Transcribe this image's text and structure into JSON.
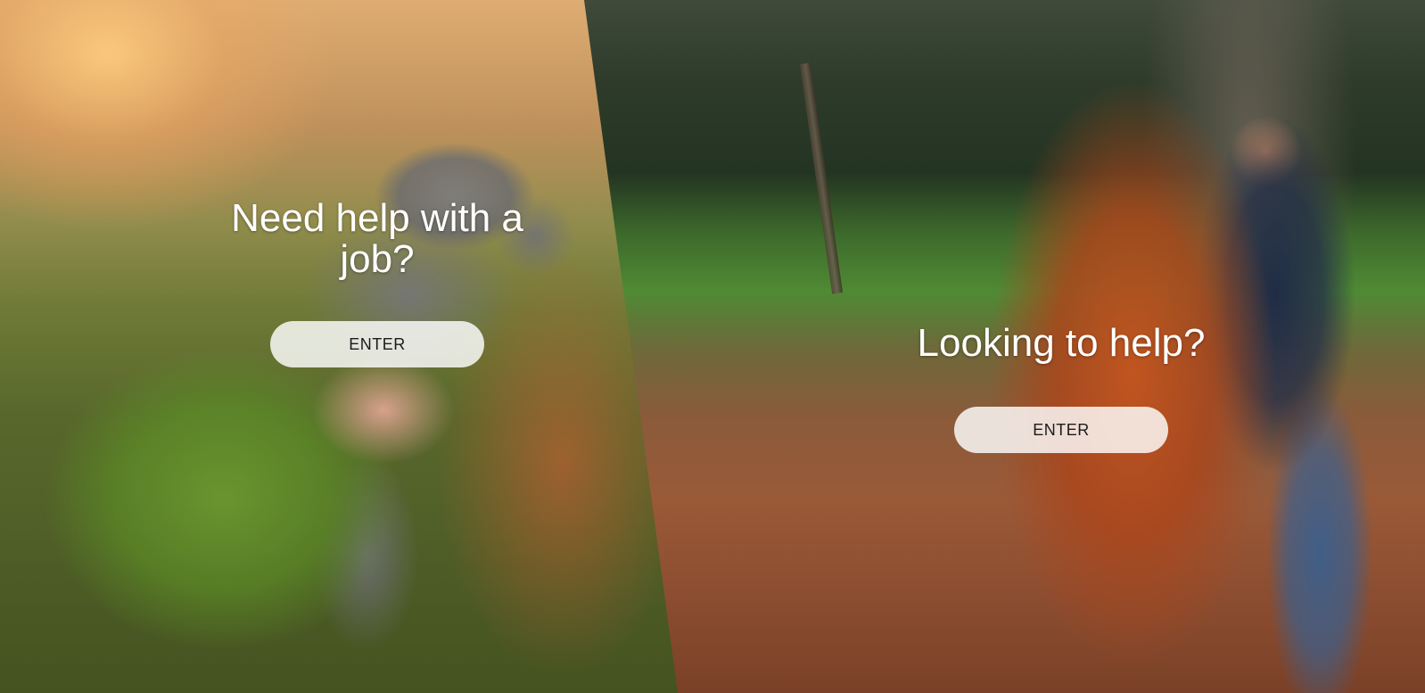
{
  "left_panel": {
    "heading": "Need help with a job?",
    "button_label": "ENTER",
    "image_subject": "toddler-in-knit-hat-photo"
  },
  "right_panel": {
    "heading": "Looking to help?",
    "button_label": "ENTER",
    "image_subject": "child-throwing-autumn-leaves-photo"
  },
  "colors": {
    "heading_text": "#ffffff",
    "button_background": "#ffffffd1",
    "button_text": "#1b1b1b"
  }
}
